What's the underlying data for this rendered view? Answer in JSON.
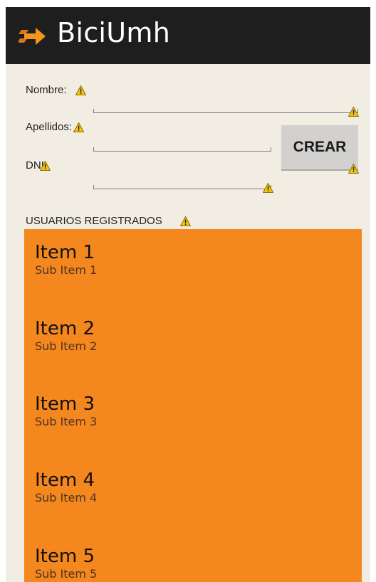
{
  "app": {
    "title": "BiciUmh",
    "icon": "arrow-right-icon",
    "accent": "#f5871f"
  },
  "form": {
    "nombre_label": "Nombre:",
    "apellidos_label": "Apellidos:",
    "dni_label": "DNI:",
    "nombre_value": "",
    "apellidos_value": "",
    "dni_value": "",
    "create_button": "CREAR"
  },
  "users": {
    "header": "USUARIOS REGISTRADOS",
    "items": [
      {
        "title": "Item 1",
        "subtitle": "Sub Item 1"
      },
      {
        "title": "Item 2",
        "subtitle": "Sub Item 2"
      },
      {
        "title": "Item 3",
        "subtitle": "Sub Item 3"
      },
      {
        "title": "Item 4",
        "subtitle": "Sub Item 4"
      },
      {
        "title": "Item 5",
        "subtitle": "Sub Item 5"
      }
    ]
  },
  "icons": {
    "warning": "warning-icon"
  }
}
